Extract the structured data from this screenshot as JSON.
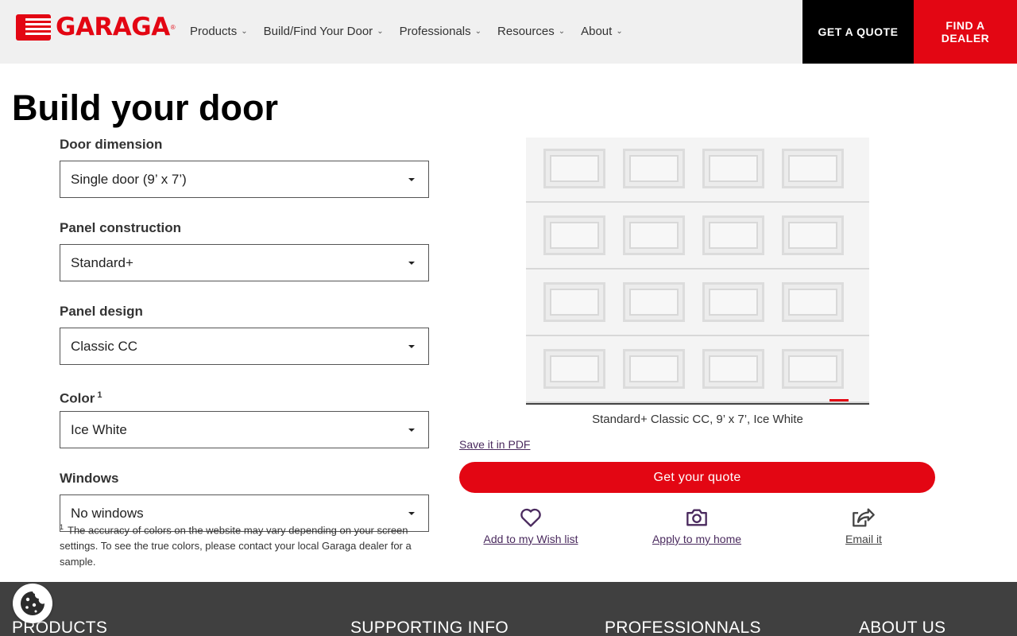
{
  "brand": {
    "name": "GARAGA",
    "reg": "®"
  },
  "nav": [
    {
      "label": "Products"
    },
    {
      "label": "Build/Find Your Door"
    },
    {
      "label": "Professionals"
    },
    {
      "label": "Resources"
    },
    {
      "label": "About"
    }
  ],
  "header_buttons": {
    "quote": "GET A QUOTE",
    "dealer": "FIND A DEALER"
  },
  "page": {
    "title": "Build your door"
  },
  "form": {
    "dimension": {
      "label": "Door dimension",
      "value": "Single door (9’ x 7’)"
    },
    "construction": {
      "label": "Panel construction",
      "value": "Standard+"
    },
    "design": {
      "label": "Panel design",
      "value": "Classic CC"
    },
    "color": {
      "label": "Color",
      "sup": "1",
      "value": "Ice White"
    },
    "windows": {
      "label": "Windows",
      "value": "No windows"
    }
  },
  "footnote": {
    "sup": "1",
    "text": "The accuracy of colors on the website may vary depending on your screen settings. To see the true colors, please contact your local Garaga dealer for a sample."
  },
  "preview": {
    "caption": "Standard+ Classic CC, 9’ x 7’, Ice White",
    "door_color": "#f4f4f4"
  },
  "actions": {
    "pdf": "Save it in PDF",
    "get_quote": "Get your quote",
    "wishlist": "Add to my Wish list",
    "apply_home": "Apply to my home",
    "email": "Email it"
  },
  "footer": {
    "products": "PRODUCTS",
    "supporting": "SUPPORTING INFO",
    "professionals": "PROFESSIONNALS",
    "about": "ABOUT US"
  },
  "colors": {
    "brand_red": "#e30613",
    "black": "#000000",
    "footer_bg": "#404040",
    "link_purple": "#4a2a5e"
  },
  "icons": [
    "chevron-down-icon",
    "caret-down-icon",
    "heart-icon",
    "camera-icon",
    "share-icon",
    "cookie-icon"
  ]
}
